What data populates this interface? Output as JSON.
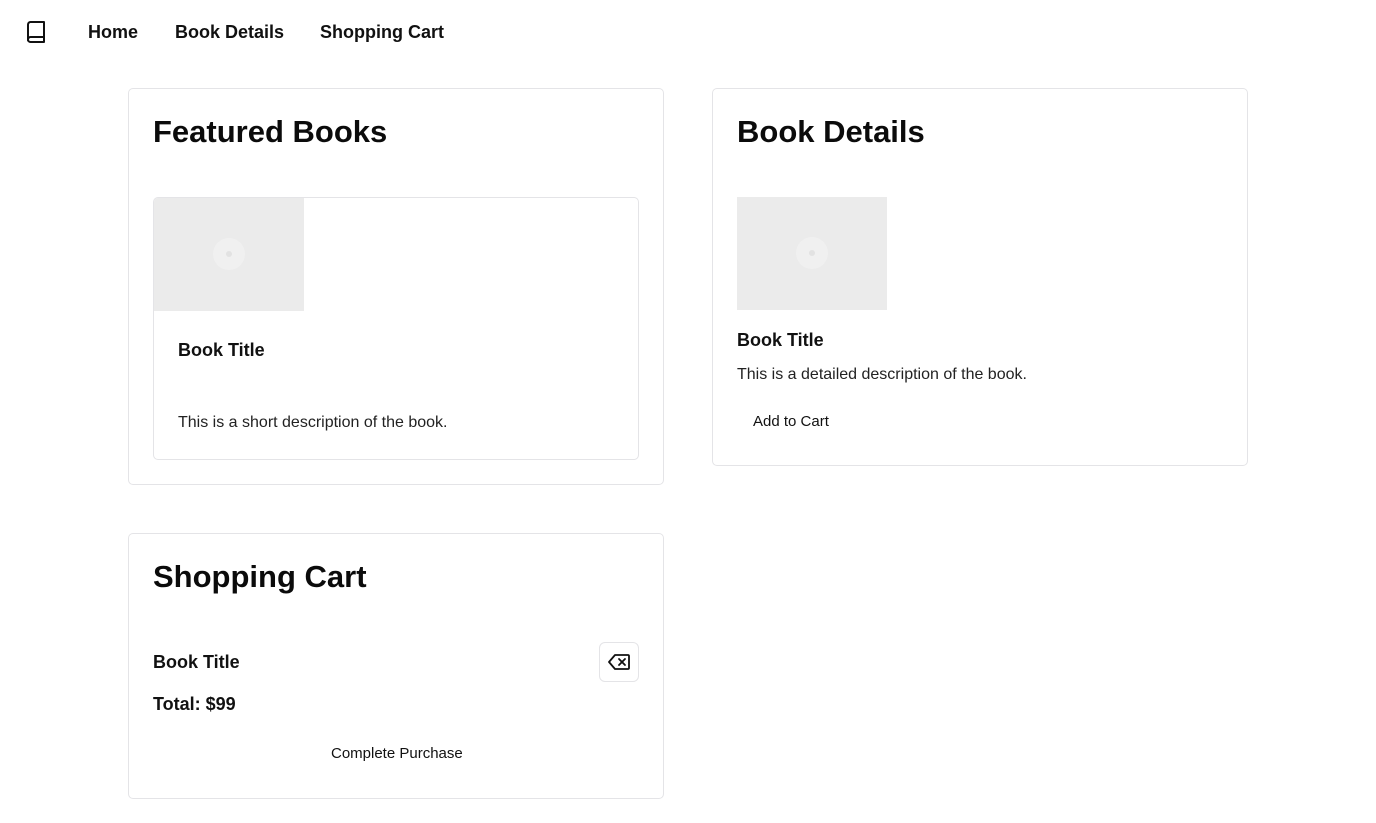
{
  "nav": {
    "logo_icon": "book-icon",
    "links": [
      "Home",
      "Book Details",
      "Shopping Cart"
    ]
  },
  "featured": {
    "title": "Featured Books",
    "book": {
      "image_icon": "image-placeholder-icon",
      "title": "Book Title",
      "description": "This is a short description of the book."
    }
  },
  "details": {
    "title": "Book Details",
    "book": {
      "image_icon": "image-placeholder-icon",
      "title": "Book Title",
      "description": "This is a detailed description of the book."
    },
    "add_to_cart_label": "Add to Cart"
  },
  "cart": {
    "title": "Shopping Cart",
    "item_title": "Book Title",
    "remove_icon": "delete-icon",
    "total": "Total: $99",
    "complete_label": "Complete Purchase"
  },
  "colors": {
    "border": "#e4e4e7",
    "placeholder": "#ebebeb",
    "text": "#111111"
  }
}
